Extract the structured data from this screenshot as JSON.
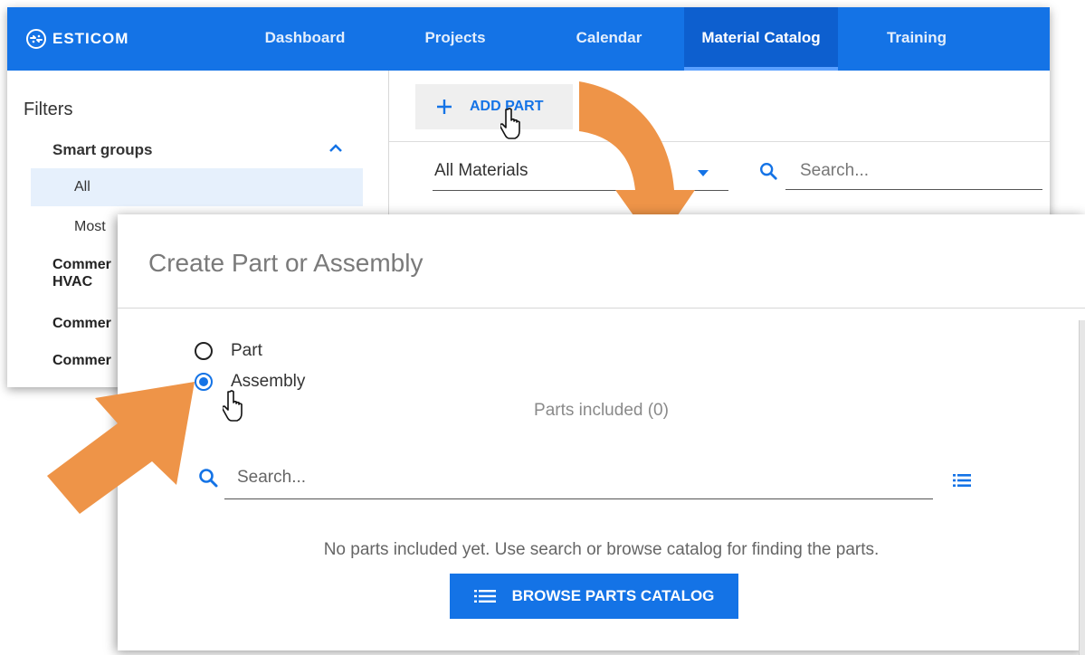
{
  "app": {
    "brand": "ESTICOM",
    "nav": [
      {
        "label": "Dashboard"
      },
      {
        "label": "Projects"
      },
      {
        "label": "Calendar"
      },
      {
        "label": "Material Catalog"
      },
      {
        "label": "Training"
      }
    ],
    "active_nav": "Material Catalog",
    "accent_color": "#1473e6"
  },
  "sidebar": {
    "title": "Filters",
    "smart_groups_label": "Smart groups",
    "items": [
      "All",
      "Most"
    ],
    "groups": [
      "Commer\nHVAC",
      "Commer",
      "Commer"
    ]
  },
  "toolbar": {
    "add_part_label": "ADD PART",
    "materials_value": "All Materials",
    "search_placeholder": "Search..."
  },
  "dialog": {
    "title": "Create Part or Assembly",
    "radio_options": [
      {
        "label": "Part",
        "checked": false
      },
      {
        "label": "Assembly",
        "checked": true
      }
    ],
    "parts_included": "Parts included (0)",
    "search_placeholder": "Search...",
    "empty_message": "No parts included yet. Use search or browse catalog for finding the parts.",
    "browse_label": "BROWSE PARTS CATALOG"
  },
  "icons": {
    "logo": "esticom-logo-icon",
    "search": "search-icon",
    "plus": "plus-icon",
    "list": "list-icon",
    "chevron": "chevron-up-icon",
    "caret": "caret-down-icon",
    "cursor": "hand-cursor-icon",
    "arrow": "orange-arrow-icon"
  },
  "arrow_color": "#ee9448"
}
